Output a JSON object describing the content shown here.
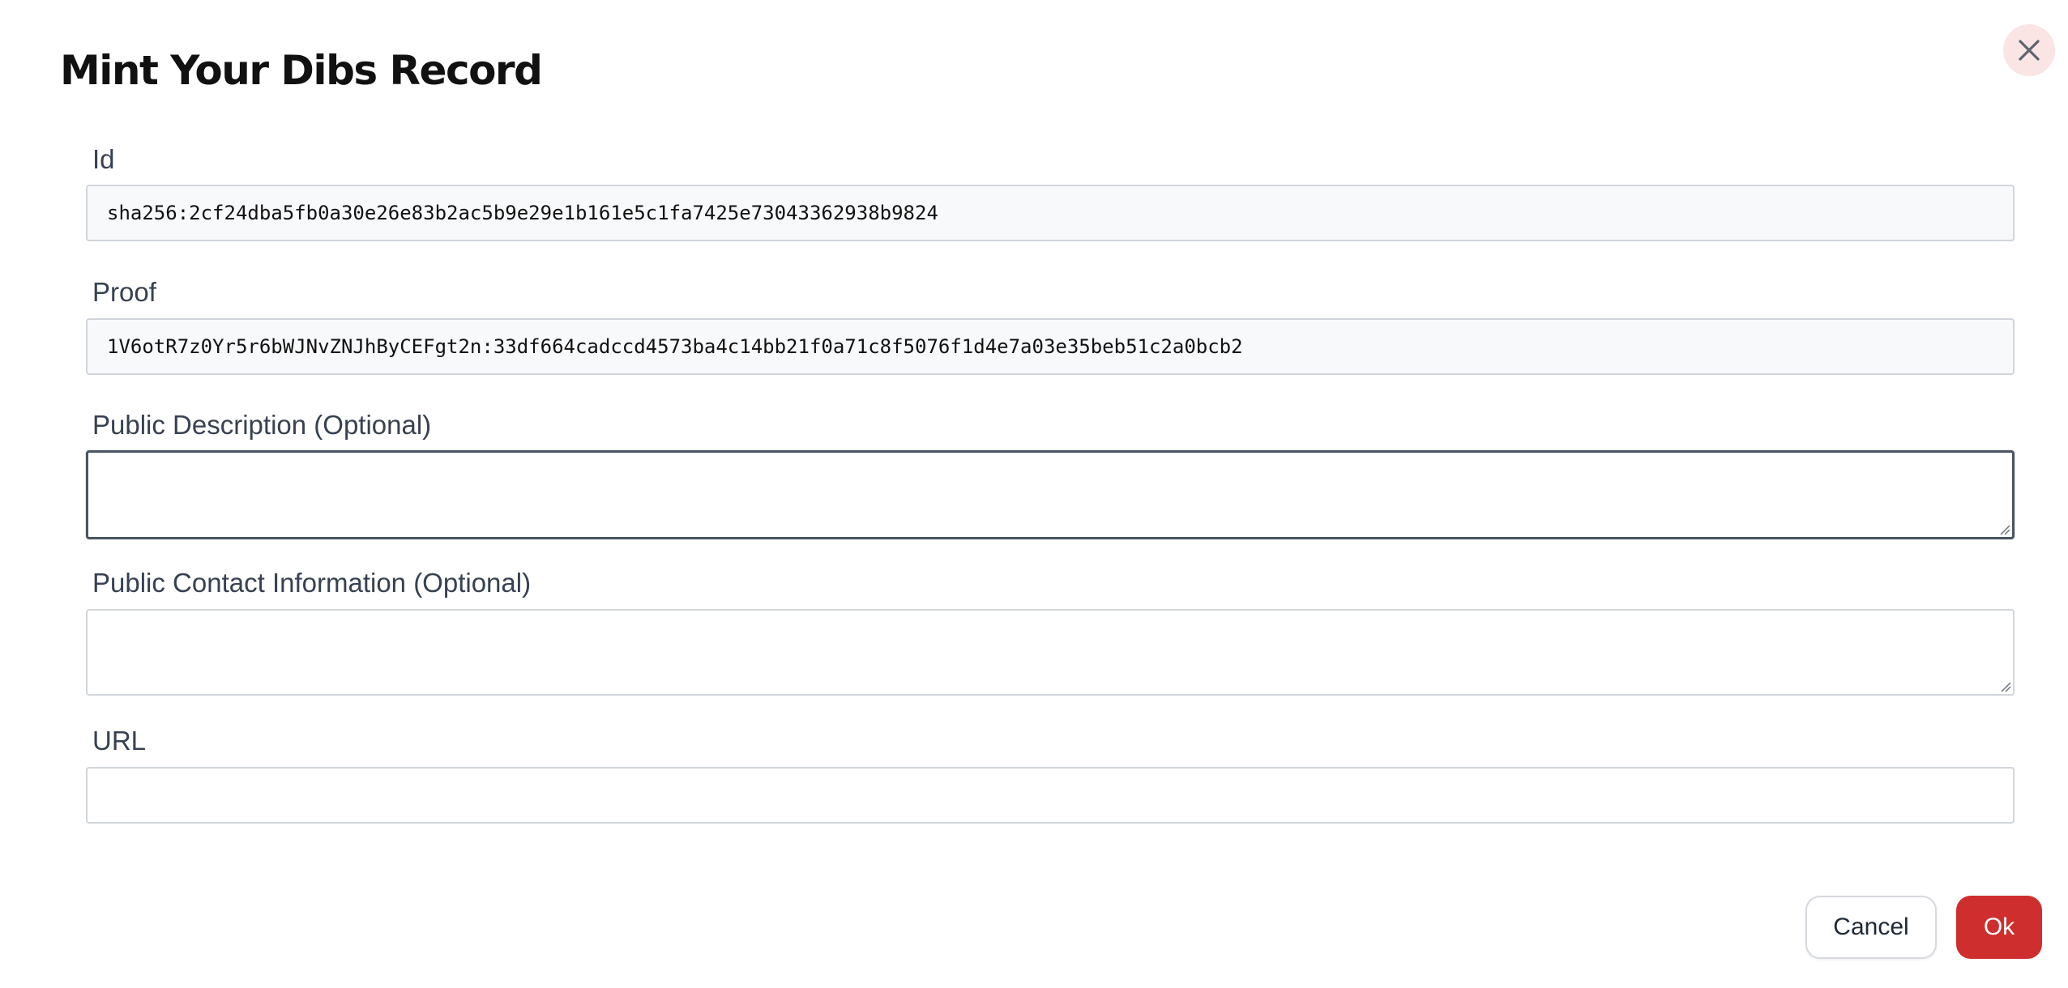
{
  "dialog": {
    "title": "Mint Your Dibs Record",
    "close_icon": "close-icon"
  },
  "form": {
    "id": {
      "label": "Id",
      "value": "sha256:2cf24dba5fb0a30e26e83b2ac5b9e29e1b161e5c1fa7425e73043362938b9824"
    },
    "proof": {
      "label": "Proof",
      "value": "1V6otR7z0Yr5r6bWJNvZNJhByCEFgt2n:33df664cadccd4573ba4c14bb21f0a71c8f5076f1d4e7a03e35beb51c2a0bcb2"
    },
    "description": {
      "label": "Public Description (Optional)",
      "value": ""
    },
    "contact": {
      "label": "Public Contact Information (Optional)",
      "value": ""
    },
    "url": {
      "label": "URL",
      "value": ""
    }
  },
  "actions": {
    "cancel_label": "Cancel",
    "ok_label": "Ok"
  },
  "colors": {
    "ok_button": "#cf2e2e",
    "close_bg": "#fbe4e4",
    "label_text": "#374151"
  }
}
